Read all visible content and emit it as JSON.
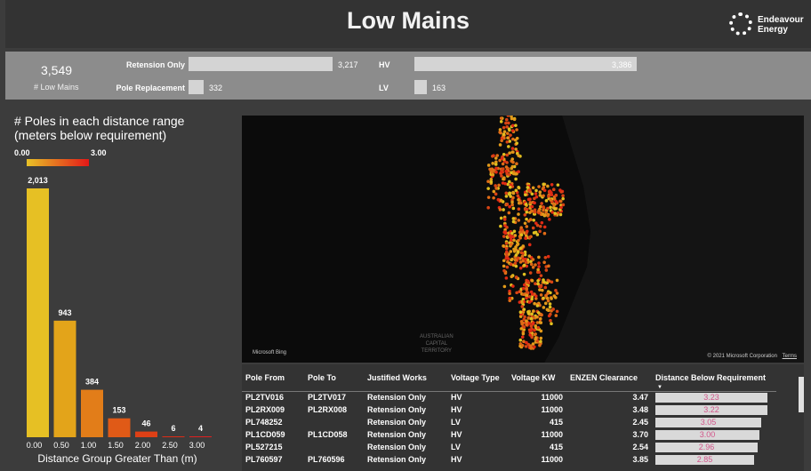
{
  "header": {
    "title": "Low Mains",
    "logo_line1": "Endeavour",
    "logo_line2": "Energy"
  },
  "kpis": {
    "total_value": "3,549",
    "total_label": "# Low Mains",
    "work_bars": [
      {
        "label": "Retension Only",
        "value": "3,217",
        "count": 3217
      },
      {
        "label": "Pole Replacement",
        "value": "332",
        "count": 332
      }
    ],
    "voltage_bars": [
      {
        "label": "HV",
        "value": "3,386",
        "count": 3386
      },
      {
        "label": "LV",
        "value": "163",
        "count": 163
      }
    ]
  },
  "distance_chart": {
    "title_line1": "# Poles in each distance range",
    "title_line2": "(meters below requirement)",
    "gradient_min": "0.00",
    "gradient_max": "3.00",
    "xlabel": "Distance Group Greater Than (m)"
  },
  "chart_data": {
    "type": "bar",
    "categories": [
      "0.00",
      "0.50",
      "1.00",
      "1.50",
      "2.00",
      "2.50",
      "3.00"
    ],
    "values": [
      2013,
      943,
      384,
      153,
      46,
      6,
      4
    ],
    "labels": [
      "2,013",
      "943",
      "384",
      "153",
      "46",
      "6",
      "4"
    ],
    "colors": [
      "#e6c024",
      "#e3a41a",
      "#e27d19",
      "#e05a17",
      "#de4016",
      "#de2c16",
      "#e02020"
    ],
    "xlabel": "Distance Group Greater Than (m)",
    "ylim": [
      0,
      2013
    ]
  },
  "map": {
    "attribution": "© 2021 Microsoft Corporation",
    "terms": "Terms",
    "bing": "Microsoft Bing",
    "territory": [
      "AUSTRALIAN",
      "CAPITAL",
      "TERRITORY"
    ]
  },
  "table": {
    "columns": [
      "Pole From",
      "Pole To",
      "Justified Works",
      "Voltage Type",
      "Voltage KW",
      "ENZEN Clearance",
      "Distance Below Requirement"
    ],
    "rows": [
      {
        "from": "PL2TV016",
        "to": "PL2TV017",
        "works": "Retension Only",
        "vtype": "HV",
        "kw": "11000",
        "clearance": "3.47",
        "dist": "3.23",
        "dist_num": 3.23
      },
      {
        "from": "PL2RX009",
        "to": "PL2RX008",
        "works": "Retension Only",
        "vtype": "HV",
        "kw": "11000",
        "clearance": "3.48",
        "dist": "3.22",
        "dist_num": 3.22
      },
      {
        "from": "PL748252",
        "to": "",
        "works": "Retension Only",
        "vtype": "LV",
        "kw": "415",
        "clearance": "2.45",
        "dist": "3.05",
        "dist_num": 3.05
      },
      {
        "from": "PL1CD059",
        "to": "PL1CD058",
        "works": "Retension Only",
        "vtype": "HV",
        "kw": "11000",
        "clearance": "3.70",
        "dist": "3.00",
        "dist_num": 3.0
      },
      {
        "from": "PL527215",
        "to": "",
        "works": "Retension Only",
        "vtype": "LV",
        "kw": "415",
        "clearance": "2.54",
        "dist": "2.96",
        "dist_num": 2.96
      },
      {
        "from": "PL760597",
        "to": "PL760596",
        "works": "Retension Only",
        "vtype": "HV",
        "kw": "11000",
        "clearance": "3.85",
        "dist": "2.85",
        "dist_num": 2.85
      }
    ]
  }
}
